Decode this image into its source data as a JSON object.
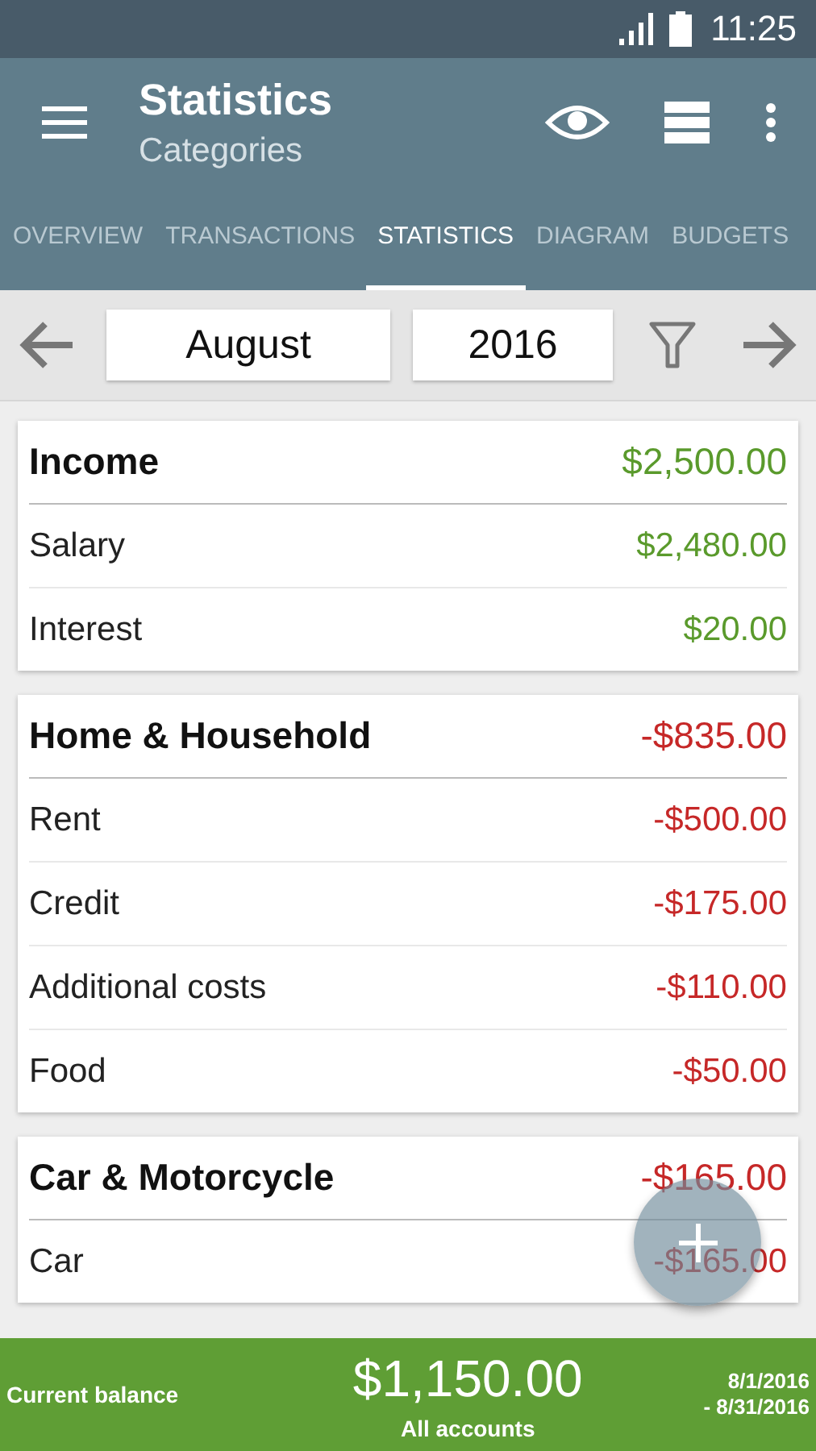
{
  "status_bar": {
    "time": "11:25"
  },
  "app_bar": {
    "title": "Statistics",
    "subtitle": "Categories"
  },
  "tabs": [
    {
      "label": "OVERVIEW",
      "selected": false
    },
    {
      "label": "TRANSACTIONS",
      "selected": false
    },
    {
      "label": "STATISTICS",
      "selected": true
    },
    {
      "label": "DIAGRAM",
      "selected": false
    },
    {
      "label": "BUDGETS",
      "selected": false
    }
  ],
  "period": {
    "month": "August",
    "year": "2016"
  },
  "groups": [
    {
      "kind": "income",
      "name": "Income",
      "total": "$2,500.00",
      "rows": [
        {
          "name": "Salary",
          "amount": "$2,480.00"
        },
        {
          "name": "Interest",
          "amount": "$20.00"
        }
      ]
    },
    {
      "kind": "expense",
      "name": "Home & Household",
      "total": "-$835.00",
      "rows": [
        {
          "name": "Rent",
          "amount": "-$500.00"
        },
        {
          "name": "Credit",
          "amount": "-$175.00"
        },
        {
          "name": "Additional costs",
          "amount": "-$110.00"
        },
        {
          "name": "Food",
          "amount": "-$50.00"
        }
      ]
    },
    {
      "kind": "expense",
      "name": "Car & Motorcycle",
      "total": "-$165.00",
      "rows": [
        {
          "name": "Car",
          "amount": "-$165.00"
        }
      ]
    }
  ],
  "footer": {
    "label": "Current balance",
    "balance": "$1,150.00",
    "accounts": "All accounts",
    "period_start": "8/1/2016",
    "period_end": "- 8/31/2016"
  }
}
